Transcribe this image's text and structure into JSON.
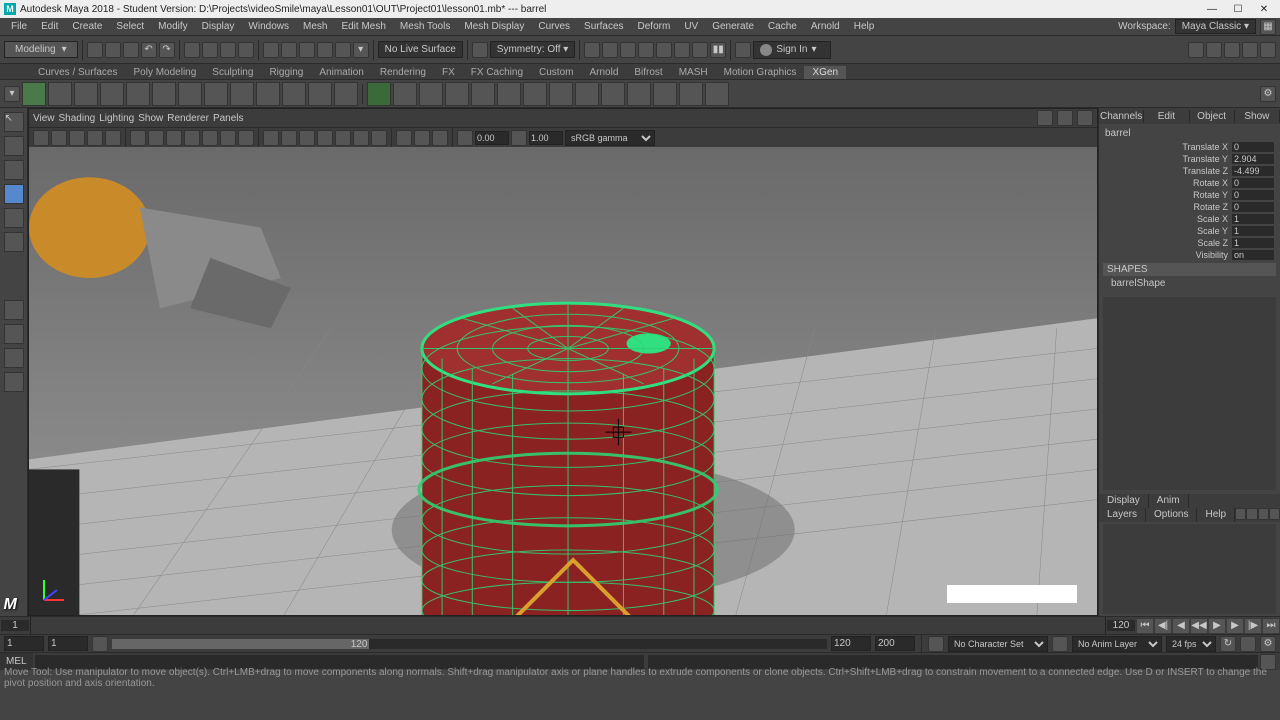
{
  "title": "Autodesk Maya 2018 - Student Version: D:\\Projects\\videoSmile\\maya\\Lesson01\\OUT\\Project01\\lesson01.mb*   ---   barrel",
  "menu": [
    "File",
    "Edit",
    "Create",
    "Select",
    "Modify",
    "Display",
    "Windows",
    "Mesh",
    "Edit Mesh",
    "Mesh Tools",
    "Mesh Display",
    "Curves",
    "Surfaces",
    "Deform",
    "UV",
    "Generate",
    "Cache",
    "Arnold",
    "Help"
  ],
  "workspace_label": "Workspace:",
  "workspace_value": "Maya Classic",
  "mode": "Modeling",
  "surface_label": "No Live Surface",
  "symmetry_label": "Symmetry: Off",
  "signin": "Sign In",
  "shelf_tabs": [
    "Curves / Surfaces",
    "Poly Modeling",
    "Sculpting",
    "Rigging",
    "Animation",
    "Rendering",
    "FX",
    "FX Caching",
    "Custom",
    "Arnold",
    "Bifrost",
    "MASH",
    "Motion Graphics",
    "XGen"
  ],
  "view_menu": [
    "View",
    "Shading",
    "Lighting",
    "Show",
    "Renderer",
    "Panels"
  ],
  "num1": "0.00",
  "num2": "1.00",
  "gamma": "sRGB gamma",
  "channel_tabs": [
    "Channels",
    "Edit",
    "Object",
    "Show"
  ],
  "object_name": "barrel",
  "transforms": [
    {
      "lbl": "Translate X",
      "val": "0"
    },
    {
      "lbl": "Translate Y",
      "val": "2.904"
    },
    {
      "lbl": "Translate Z",
      "val": "-4.499"
    },
    {
      "lbl": "Rotate X",
      "val": "0"
    },
    {
      "lbl": "Rotate Y",
      "val": "0"
    },
    {
      "lbl": "Rotate Z",
      "val": "0"
    },
    {
      "lbl": "Scale X",
      "val": "1"
    },
    {
      "lbl": "Scale Y",
      "val": "1"
    },
    {
      "lbl": "Scale Z",
      "val": "1"
    },
    {
      "lbl": "Visibility",
      "val": "on"
    }
  ],
  "shapes_label": "SHAPES",
  "shape_name": "barrelShape",
  "layer_tabs_top": [
    "Display",
    "Anim"
  ],
  "layer_tabs_bot": [
    "Layers",
    "Options",
    "Help"
  ],
  "timeline_start": "1",
  "timeline_end": "120",
  "range_start": "1",
  "range_end": "120",
  "range_total_end": "200",
  "charset": "No Character Set",
  "animlayer": "No Anim Layer",
  "fps": "24 fps",
  "cmd_label": "MEL",
  "status_help": "Move Tool: Use manipulator to move object(s). Ctrl+LMB+drag to move components along normals. Shift+drag manipulator axis or plane handles to extrude components or clone objects. Ctrl+Shift+LMB+drag to constrain movement to a connected edge. Use D or INSERT to change the pivot position and axis orientation."
}
